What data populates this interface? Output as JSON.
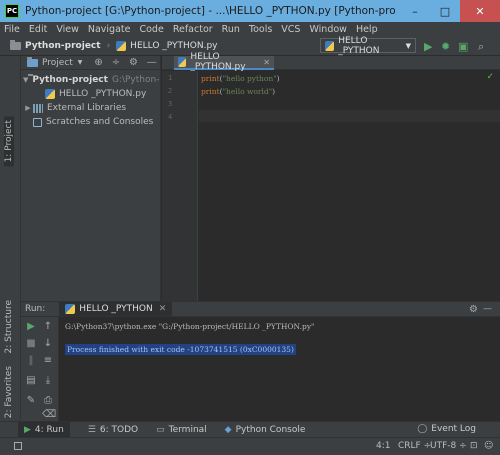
{
  "window": {
    "title": "Python-project [G:\\Python-project] - ...\\HELLO _PYTHON.py [Python-project] - PyCh...",
    "app_icon": "PC",
    "minimize": "–",
    "maximize": "□",
    "close": "✕"
  },
  "menu": [
    "File",
    "Edit",
    "View",
    "Navigate",
    "Code",
    "Refactor",
    "Run",
    "Tools",
    "VCS",
    "Window",
    "Help"
  ],
  "navbar": {
    "project": "Python-project",
    "file": "HELLO _PYTHON.py",
    "run_config": "HELLO _PYTHON"
  },
  "left_strip": {
    "project_tab": "1: Project",
    "structure_tab": "2: Structure",
    "favorites_tab": "2: Favorites"
  },
  "project_panel": {
    "header": "Project",
    "tree": {
      "root_name": "Python-project",
      "root_path": "G:\\Python-pro",
      "file": "HELLO _PYTHON.py",
      "ext_libs": "External Libraries",
      "scratches": "Scratches and Consoles"
    }
  },
  "editor": {
    "tab": "HELLO _PYTHON.py",
    "line_numbers": [
      "1",
      "2",
      "3",
      "4"
    ],
    "lines": [
      {
        "kw": "print",
        "open": "(",
        "str": "\"hello python\"",
        "close": ")"
      },
      {
        "kw": "print",
        "open": "(",
        "str": "\"hello world\"",
        "close": ")"
      }
    ]
  },
  "run": {
    "label": "Run:",
    "tab": "HELLO _PYTHON",
    "command": "G:\\Python37\\python.exe \"G:/Python-project/HELLO _PYTHON.py\"",
    "exit_message": "Process finished with exit code -1073741515 (0xC0000135)"
  },
  "bottom_tools": {
    "run": "4: Run",
    "todo": "6: TODO",
    "terminal": "Terminal",
    "python_console": "Python Console",
    "event_log": "Event Log"
  },
  "status": {
    "position": "4:1",
    "line_sep": "CRLF ÷",
    "encoding": "UTF-8 ÷"
  },
  "colors": {
    "titlebar": "#6aaee0",
    "panel": "#3c3f41",
    "editor_bg": "#2b2b2b",
    "keyword": "#cc7832",
    "string": "#6a8759",
    "selection": "#214283"
  }
}
